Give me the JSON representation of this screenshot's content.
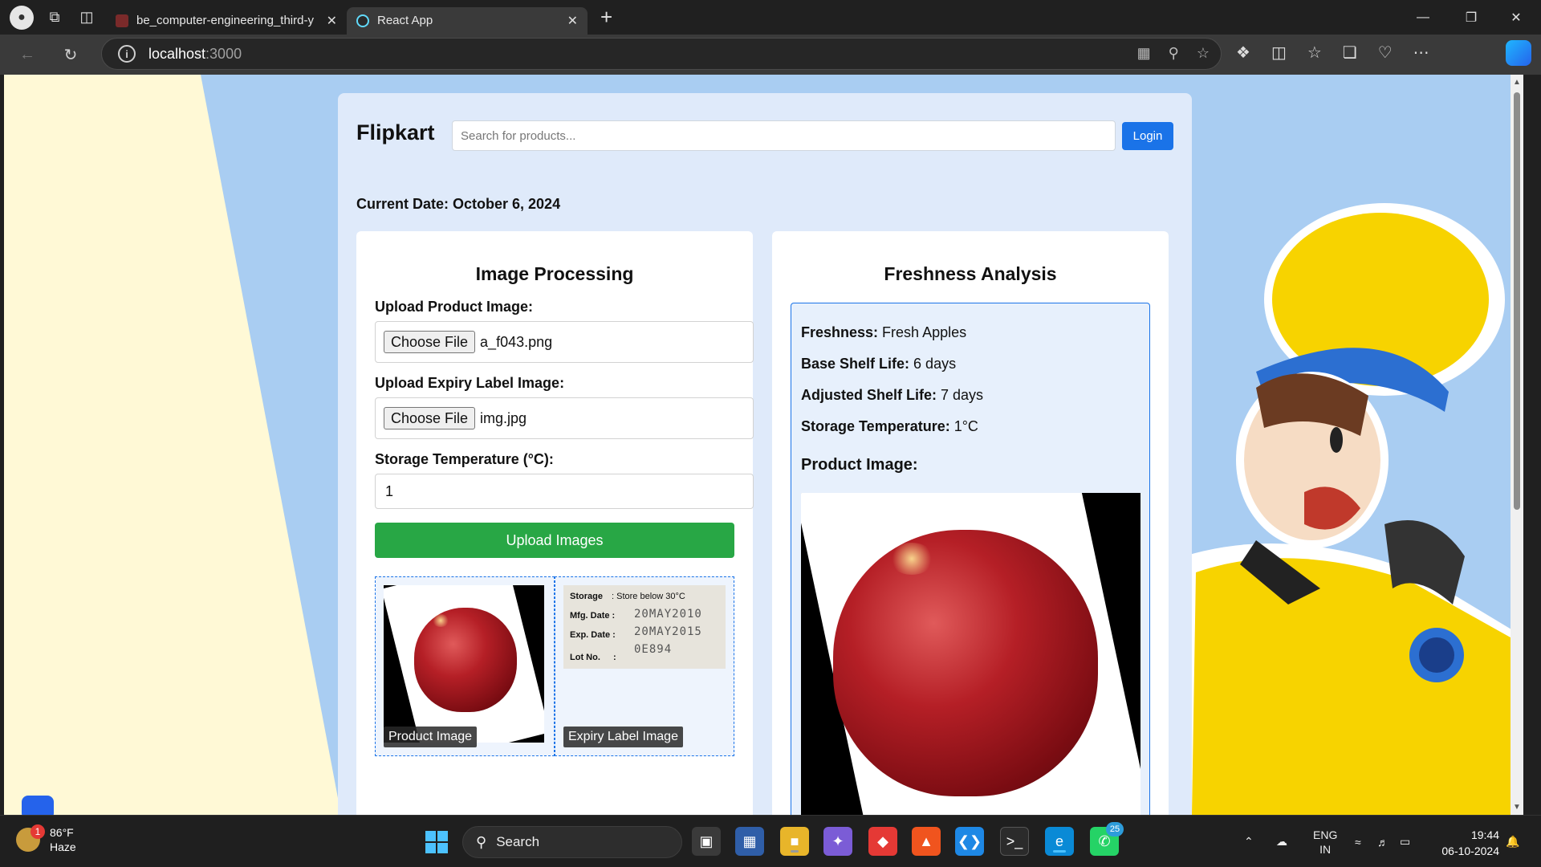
{
  "browser": {
    "tabs": [
      {
        "label": "be_computer-engineering_third-y",
        "active": false
      },
      {
        "label": "React App",
        "active": true
      }
    ],
    "url_host": "localhost",
    "url_port": ":3000"
  },
  "app": {
    "brand": "Flipkart",
    "search_placeholder": "Search for products...",
    "login_label": "Login",
    "current_date": "Current Date: October 6, 2024",
    "image_processing": {
      "title": "Image Processing",
      "product_label": "Upload Product Image:",
      "product_file_button": "Choose File",
      "product_file_name": "a_f043.png",
      "expiry_label": "Upload Expiry Label Image:",
      "expiry_file_button": "Choose File",
      "expiry_file_name": "img.jpg",
      "temp_label": "Storage Temperature (°C):",
      "temp_value": "1",
      "upload_button": "Upload Images",
      "product_caption": "Product Image",
      "expiry_caption": "Expiry Label Image",
      "expiry_label_text": {
        "storage_key": "Storage",
        "storage_val": ": Store below 30°C",
        "mfg_key": "Mfg. Date :",
        "mfg_val": "20MAY2010",
        "exp_key": "Exp. Date :",
        "exp_val": "20MAY2015",
        "lot_key": "Lot No.",
        "lot_sep": ":",
        "lot_val": "0E894"
      }
    },
    "freshness": {
      "title": "Freshness Analysis",
      "freshness_key": "Freshness:",
      "freshness_val": " Fresh Apples",
      "base_key": "Base Shelf Life:",
      "base_val": " 6 days",
      "adjusted_key": "Adjusted Shelf Life:",
      "adjusted_val": " 7 days",
      "storage_key": "Storage Temperature:",
      "storage_val": " 1°C",
      "product_image_heading": "Product Image:"
    }
  },
  "taskbar": {
    "weather_temp": "86°F",
    "weather_cond": "Haze",
    "weather_badge": "1",
    "search_label": "Search",
    "whatsapp_badge": "25",
    "lang_top": "ENG",
    "lang_bottom": "IN",
    "time": "19:44",
    "date": "06-10-2024"
  },
  "colors": {
    "accent": "#1a73e8",
    "upload_green": "#28a745",
    "app_bg": "#dfeafa"
  }
}
